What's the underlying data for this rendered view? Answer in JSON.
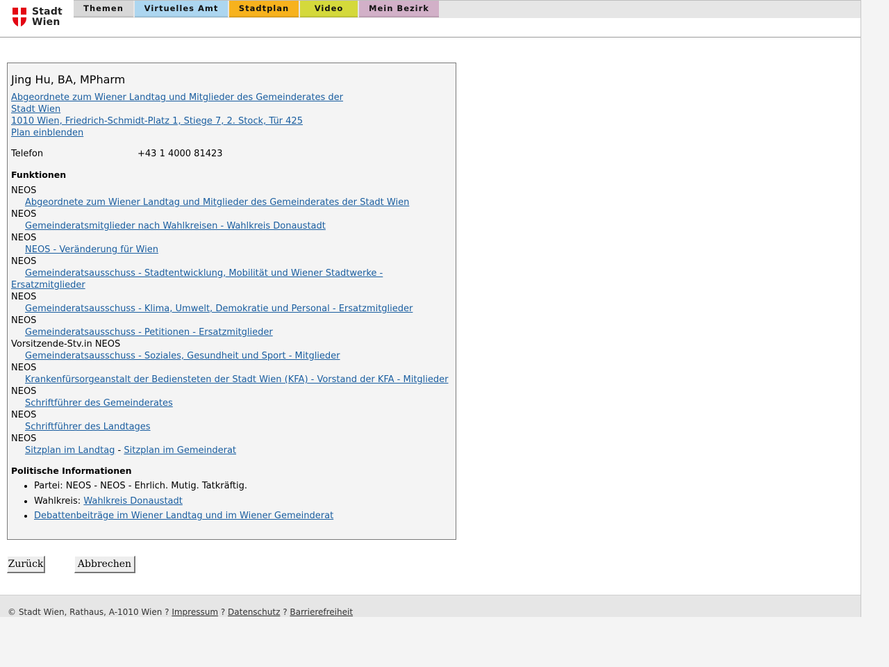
{
  "header": {
    "logo_line1": "Stadt",
    "logo_line2": "Wien",
    "tabs": [
      "Themen",
      "Virtuelles Amt",
      "Stadtplan",
      "Video",
      "Mein Bezirk"
    ],
    "colors": {
      "themen": "#d8d8d8",
      "amt": "#acd6f0",
      "plan": "#f7b21d",
      "video": "#d4d93b",
      "bezirk": "#d2b0c8",
      "logo_red": "#e30613"
    }
  },
  "person": {
    "name": "Jing Hu, BA, MPharm",
    "office_line1": "Abgeordnete zum Wiener Landtag und Mitglieder des Gemeinderates der",
    "office_line2": "Stadt Wien ",
    "address": "1010 Wien, Friedrich-Schmidt-Platz 1, Stiege 7, 2. Stock, Tür 425",
    "plan_link": "Plan einblenden",
    "phone_label": "Telefon",
    "phone_value": "+43 1 4000 81423"
  },
  "functions": {
    "heading": "Funktionen",
    "items": [
      {
        "org": "NEOS",
        "link": "Abgeordnete zum Wiener Landtag und Mitglieder des Gemeinderates der Stadt Wien"
      },
      {
        "org": "NEOS",
        "link": "Gemeinderatsmitglieder nach Wahlkreisen - Wahlkreis Donaustadt"
      },
      {
        "org": "NEOS",
        "link": "NEOS - Veränderung für Wien"
      },
      {
        "org": "NEOS",
        "link": "Gemeinderatsausschuss - Stadtentwicklung, Mobilität und Wiener Stadtwerke - Ersatzmitglieder"
      },
      {
        "org": "NEOS",
        "link": "Gemeinderatsausschuss - Klima, Umwelt, Demokratie und Personal - Ersatzmitglieder"
      },
      {
        "org": "NEOS",
        "link": "Gemeinderatsausschuss - Petitionen - Ersatzmitglieder"
      },
      {
        "org": "Vorsitzende-Stv.in NEOS",
        "link": "Gemeinderatsausschuss - Soziales, Gesundheit und Sport - Mitglieder"
      },
      {
        "org": "NEOS",
        "link": "Krankenfürsorgeanstalt der Bediensteten der Stadt Wien (KFA) - Vorstand der KFA - Mitglieder"
      },
      {
        "org": "NEOS",
        "link": "Schriftführer des Gemeinderates"
      },
      {
        "org": "NEOS",
        "link": "Schriftführer des Landtages"
      }
    ],
    "last_org": "NEOS",
    "sitzplan_landtag": "Sitzplan im Landtag",
    "sitzplan_sep": " - ",
    "sitzplan_gemeinderat": "Sitzplan im Gemeinderat"
  },
  "political": {
    "heading": "Politische Informationen",
    "party": "Partei: NEOS - NEOS - Ehrlich. Mutig. Tatkräftig.",
    "district_label": "Wahlkreis: ",
    "district_link": "Wahlkreis Donaustadt",
    "debates_link": "Debattenbeiträge im Wiener Landtag und im Wiener Gemeinderat"
  },
  "buttons": {
    "back": "Zurück",
    "cancel": "Abbrechen"
  },
  "footer": {
    "copyright": "© Stadt Wien, Rathaus, A-1010 Wien ? ",
    "impressum": "Impressum",
    "sep1": " ? ",
    "datenschutz": "Datenschutz",
    "sep2": " ? ",
    "barrierefreiheit": "Barrierefreiheit"
  }
}
